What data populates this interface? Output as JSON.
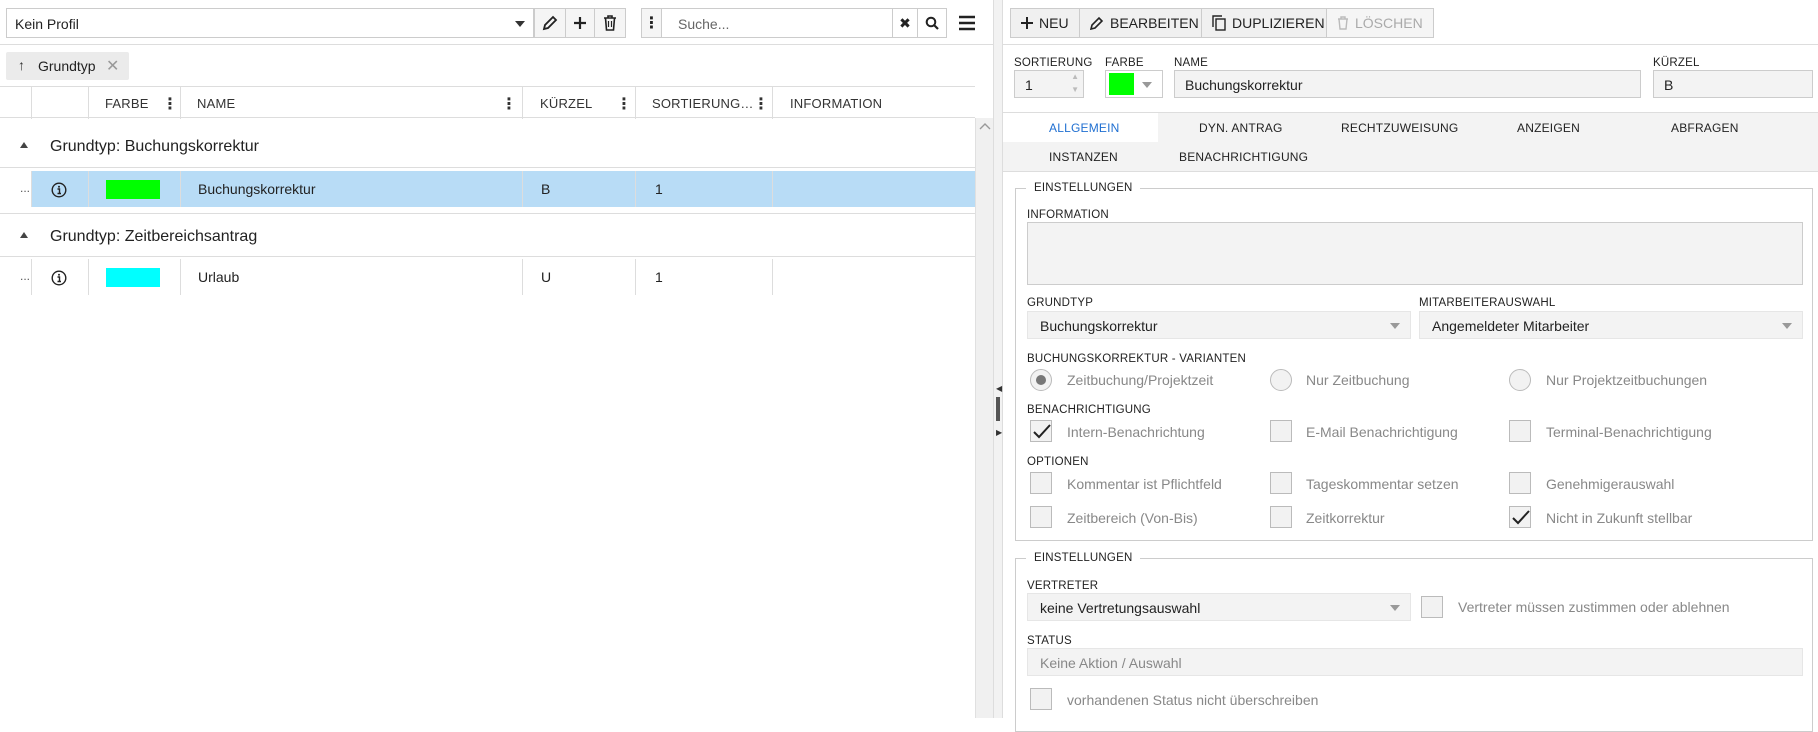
{
  "left": {
    "profile": "Kein Profil",
    "search_placeholder": "Suche...",
    "group_chip": "Grundtyp",
    "columns": [
      "FARBE",
      "NAME",
      "KÜRZEL",
      "SORTIERUNG…",
      "INFORMATION"
    ],
    "groups": [
      {
        "title": "Grundtyp: Buchungskorrektur",
        "rows": [
          {
            "color": "#00ff00",
            "name": "Buchungskorrektur",
            "short": "B",
            "sort": "1",
            "selected": true
          }
        ]
      },
      {
        "title": "Grundtyp: Zeitbereichsantrag",
        "rows": [
          {
            "color": "#00ffff",
            "name": "Urlaub",
            "short": "U",
            "sort": "1",
            "selected": false
          }
        ]
      }
    ],
    "row_prefix": "..."
  },
  "right": {
    "toolbar": {
      "new": "NEU",
      "edit": "BEARBEITEN",
      "duplicate": "DUPLIZIEREN",
      "delete": "LÖSCHEN"
    },
    "fields": {
      "sort_label": "SORTIERUNG",
      "sort_value": "1",
      "color_label": "FARBE",
      "color_value": "#00ff00",
      "name_label": "NAME",
      "name_value": "Buchungskorrektur",
      "short_label": "KÜRZEL",
      "short_value": "B"
    },
    "tabs": [
      "ALLGEMEIN",
      "DYN. ANTRAG",
      "RECHTZUWEISUNG",
      "ANZEIGEN",
      "ABFRAGEN",
      "INSTANZEN",
      "BENACHRICHTIGUNG"
    ],
    "settings1": {
      "legend": "EINSTELLUNGEN",
      "info_label": "INFORMATION",
      "grundtyp_label": "GRUNDTYP",
      "grundtyp_value": "Buchungskorrektur",
      "mitarbeiter_label": "MITARBEITERAUSWAHL",
      "mitarbeiter_value": "Angemeldeter Mitarbeiter",
      "varianten_label": "BUCHUNGSKORREKTUR - VARIANTEN",
      "varianten": [
        {
          "label": "Zeitbuchung/Projektzeit",
          "selected": true
        },
        {
          "label": "Nur Zeitbuchung",
          "selected": false
        },
        {
          "label": "Nur Projektzeitbuchungen",
          "selected": false
        }
      ],
      "benach_label": "BENACHRICHTIGUNG",
      "benach": [
        {
          "label": "Intern-Benachrichtung",
          "checked": true
        },
        {
          "label": "E-Mail Benachrichtigung",
          "checked": false
        },
        {
          "label": "Terminal-Benachrichtigung",
          "checked": false
        }
      ],
      "optionen_label": "OPTIONEN",
      "optionen": [
        {
          "label": "Kommentar ist Pflichtfeld",
          "checked": false
        },
        {
          "label": "Tageskommentar setzen",
          "checked": false
        },
        {
          "label": "Genehmigerauswahl",
          "checked": false
        },
        {
          "label": "Zeitbereich (Von-Bis)",
          "checked": false
        },
        {
          "label": "Zeitkorrektur",
          "checked": false
        },
        {
          "label": "Nicht in Zukunft stellbar",
          "checked": true
        }
      ]
    },
    "settings2": {
      "legend": "EINSTELLUNGEN",
      "vertreter_label": "VERTRETER",
      "vertreter_value": "keine Vertretungsauswahl",
      "vertreter_cb": "Vertreter müssen zustimmen oder ablehnen",
      "status_label": "STATUS",
      "status_value": "Keine Aktion / Auswahl",
      "status_cb": "vorhandenen Status nicht überschreiben"
    }
  }
}
